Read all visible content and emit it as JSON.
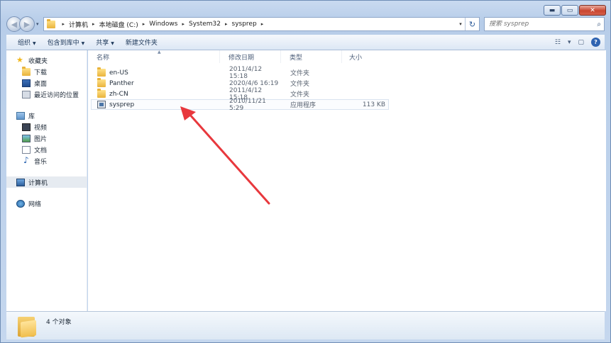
{
  "window": {
    "controls": {
      "minimize": "▬",
      "maximize": "▭",
      "close": "✕"
    }
  },
  "nav_buttons": {
    "back": "◀",
    "forward": "▶",
    "dropdown": "▾"
  },
  "address": {
    "crumbs": [
      "计算机",
      "本地磁盘 (C:)",
      "Windows",
      "System32",
      "sysprep"
    ],
    "separator": "▸",
    "dropdown": "▾",
    "refresh": "↻"
  },
  "search": {
    "placeholder": "搜索 sysprep",
    "icon": "⌕"
  },
  "toolbar": {
    "organize": "组织",
    "include_library": "包含到库中",
    "share": "共享",
    "new_folder": "新建文件夹",
    "arrow": "▼",
    "view_icon": "☷",
    "view_arrow": "▾",
    "preview_icon": "▢",
    "help": "?"
  },
  "nav": {
    "favorites": {
      "label": "收藏夹",
      "items": [
        "下载",
        "桌面",
        "最近访问的位置"
      ]
    },
    "libraries": {
      "label": "库",
      "items": [
        "视频",
        "图片",
        "文档",
        "音乐"
      ]
    },
    "computer": "计算机",
    "network": "网络"
  },
  "columns": {
    "name": "名称",
    "date": "修改日期",
    "type": "类型",
    "size": "大小",
    "sort_indicator": "▲"
  },
  "files": [
    {
      "name": "en-US",
      "date": "2011/4/12 15:18",
      "type": "文件夹",
      "size": "",
      "icon": "folder-icon"
    },
    {
      "name": "Panther",
      "date": "2020/4/6 16:19",
      "type": "文件夹",
      "size": "",
      "icon": "folder-icon"
    },
    {
      "name": "zh-CN",
      "date": "2011/4/12 15:18",
      "type": "文件夹",
      "size": "",
      "icon": "folder-icon"
    },
    {
      "name": "sysprep",
      "date": "2010/11/21 5:29",
      "type": "应用程序",
      "size": "113 KB",
      "icon": "application-icon"
    }
  ],
  "status": {
    "count": "4 个对象"
  },
  "colors": {
    "annotation_arrow": "#e8383d",
    "frame": "#b7cde9",
    "accent": "#2e63b1"
  }
}
